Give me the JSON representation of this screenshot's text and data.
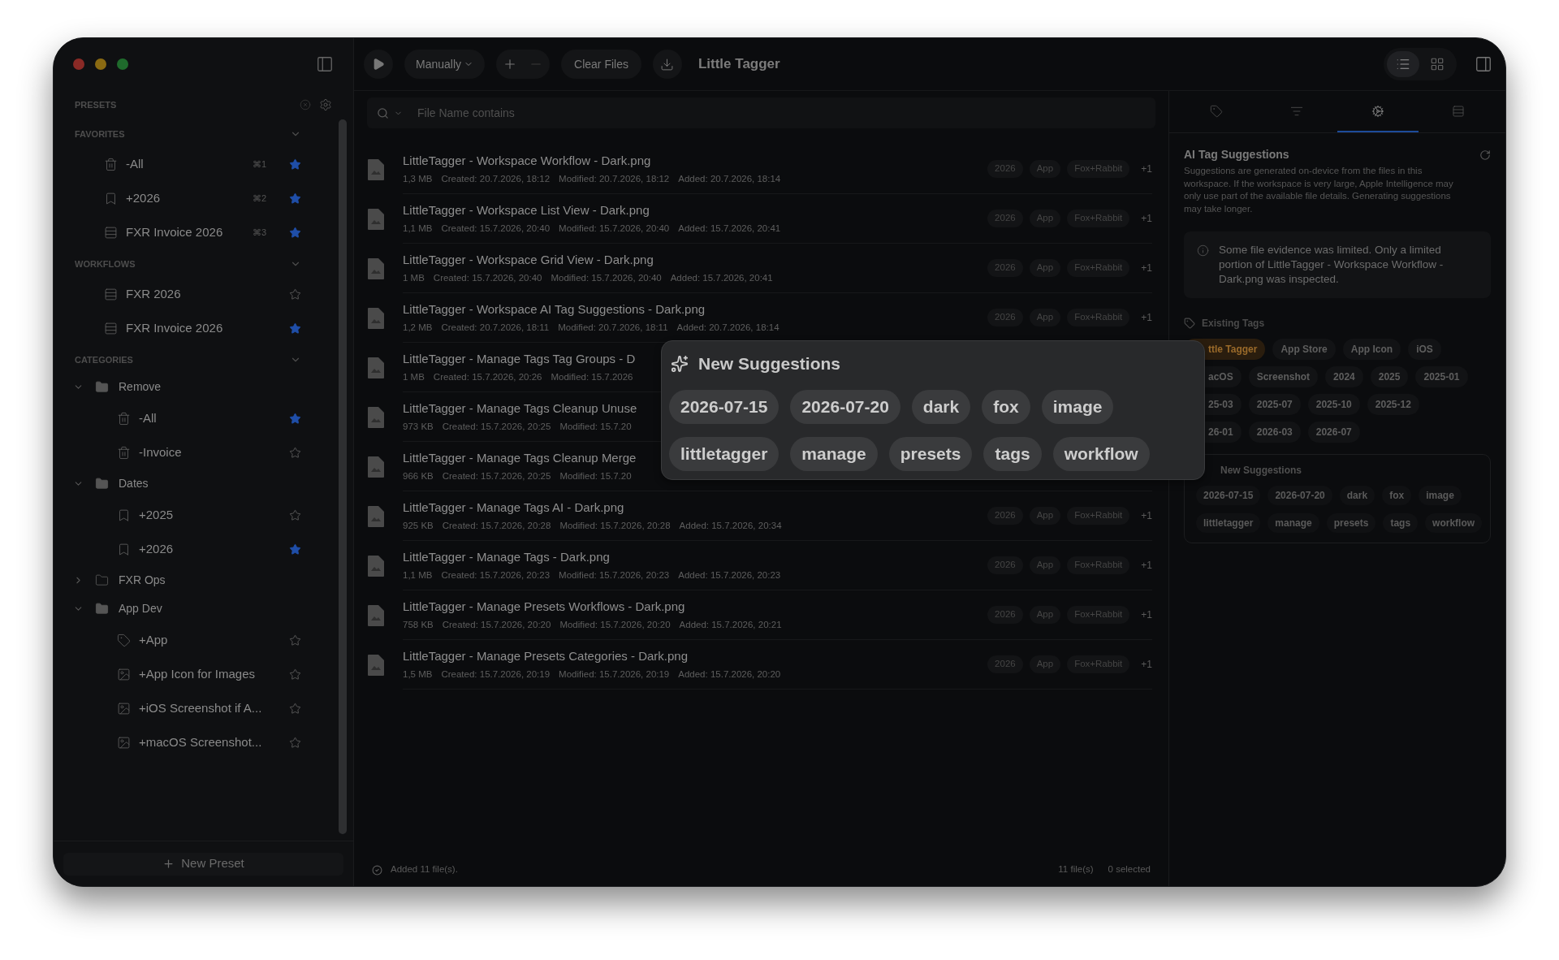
{
  "window": {
    "title": "Little Tagger"
  },
  "toolbar": {
    "run_mode": "Manually",
    "remove_disabled": true,
    "clear_button": "Clear Files",
    "views": [
      {
        "kind": "list",
        "selected": true
      },
      {
        "kind": "grid",
        "selected": false
      }
    ]
  },
  "sidebar": {
    "title": "PRESETS",
    "sections": [
      {
        "title": "FAVORITES",
        "expanded": true,
        "items": [
          {
            "kind": "remove",
            "label": "-All",
            "shortcut": "⌘1",
            "starred": true
          },
          {
            "kind": "add",
            "label": "+2026",
            "shortcut": "⌘2",
            "starred": true
          },
          {
            "kind": "workflow",
            "label": "FXR Invoice 2026",
            "shortcut": "⌘3",
            "starred": true
          }
        ]
      },
      {
        "title": "WORKFLOWS",
        "expanded": true,
        "items": [
          {
            "kind": "workflow",
            "label": "FXR 2026",
            "starred": false
          },
          {
            "kind": "workflow",
            "label": "FXR Invoice 2026",
            "starred": true
          }
        ]
      },
      {
        "title": "CATEGORIES",
        "expanded": true,
        "items": [
          {
            "kind": "folder",
            "label": "Remove",
            "expanded": true,
            "children": [
              {
                "kind": "remove",
                "label": "-All",
                "starred": true
              },
              {
                "kind": "remove",
                "label": "-Invoice",
                "starred": false
              }
            ]
          },
          {
            "kind": "folder",
            "label": "Dates",
            "expanded": true,
            "children": [
              {
                "kind": "add",
                "label": "+2025",
                "starred": false
              },
              {
                "kind": "add",
                "label": "+2026",
                "starred": true
              }
            ]
          },
          {
            "kind": "folder",
            "label": "FXR Ops",
            "expanded": false
          },
          {
            "kind": "folder",
            "label": "App Dev",
            "expanded": true,
            "children": [
              {
                "kind": "tag",
                "label": "+App",
                "starred": false
              },
              {
                "kind": "image",
                "label": "+App Icon for Images",
                "starred": false
              },
              {
                "kind": "image",
                "label": "+iOS Screenshot if A...",
                "starred": false
              },
              {
                "kind": "image",
                "label": "+macOS Screenshot...",
                "starred": false
              }
            ]
          }
        ]
      }
    ],
    "new_preset": "New Preset"
  },
  "search": {
    "placeholder": "File Name contains"
  },
  "files": [
    {
      "name": "LittleTagger - Workspace Workflow - Dark.png",
      "size": "1,3 MB",
      "created": "Created: 20.7.2026, 18:12",
      "modified": "Modified: 20.7.2026, 18:12",
      "added": "Added: 20.7.2026, 18:14",
      "tags": [
        "2026",
        "App",
        "Fox+Rabbit"
      ],
      "more": "+1"
    },
    {
      "name": "LittleTagger - Workspace List View - Dark.png",
      "size": "1,1 MB",
      "created": "Created: 15.7.2026, 20:40",
      "modified": "Modified: 15.7.2026, 20:40",
      "added": "Added: 15.7.2026, 20:41",
      "tags": [
        "2026",
        "App",
        "Fox+Rabbit"
      ],
      "more": "+1"
    },
    {
      "name": "LittleTagger - Workspace Grid View - Dark.png",
      "size": "1 MB",
      "created": "Created: 15.7.2026, 20:40",
      "modified": "Modified: 15.7.2026, 20:40",
      "added": "Added: 15.7.2026, 20:41",
      "tags": [
        "2026",
        "App",
        "Fox+Rabbit"
      ],
      "more": "+1"
    },
    {
      "name": "LittleTagger - Workspace AI Tag Suggestions - Dark.png",
      "size": "1,2 MB",
      "created": "Created: 20.7.2026, 18:11",
      "modified": "Modified: 20.7.2026, 18:11",
      "added": "Added: 20.7.2026, 18:14",
      "tags": [
        "2026",
        "App",
        "Fox+Rabbit"
      ],
      "more": "+1"
    },
    {
      "name": "LittleTagger - Manage Tags Tag Groups - D",
      "size": "1 MB",
      "created": "Created: 15.7.2026, 20:26",
      "modified": "Modified: 15.7.2026"
    },
    {
      "name": "LittleTagger - Manage Tags Cleanup Unuse",
      "size": "973 KB",
      "created": "Created: 15.7.2026, 20:25",
      "modified": "Modified: 15.7.20"
    },
    {
      "name": "LittleTagger - Manage Tags Cleanup Merge",
      "size": "966 KB",
      "created": "Created: 15.7.2026, 20:25",
      "modified": "Modified: 15.7.20"
    },
    {
      "name": "LittleTagger - Manage Tags AI - Dark.png",
      "size": "925 KB",
      "created": "Created: 15.7.2026, 20:28",
      "modified": "Modified: 15.7.2026, 20:28",
      "added": "Added: 15.7.2026, 20:34",
      "tags": [
        "2026",
        "App",
        "Fox+Rabbit"
      ],
      "more": "+1"
    },
    {
      "name": "LittleTagger - Manage Tags - Dark.png",
      "size": "1,1 MB",
      "created": "Created: 15.7.2026, 20:23",
      "modified": "Modified: 15.7.2026, 20:23",
      "added": "Added: 15.7.2026, 20:23",
      "tags": [
        "2026",
        "App",
        "Fox+Rabbit"
      ],
      "more": "+1"
    },
    {
      "name": "LittleTagger - Manage Presets Workflows - Dark.png",
      "size": "758 KB",
      "created": "Created: 15.7.2026, 20:20",
      "modified": "Modified: 15.7.2026, 20:20",
      "added": "Added: 15.7.2026, 20:21",
      "tags": [
        "2026",
        "App",
        "Fox+Rabbit"
      ],
      "more": "+1"
    },
    {
      "name": "LittleTagger - Manage Presets Categories - Dark.png",
      "size": "1,5 MB",
      "created": "Created: 15.7.2026, 20:19",
      "modified": "Modified: 15.7.2026, 20:19",
      "added": "Added: 15.7.2026, 20:20",
      "tags": [
        "2026",
        "App",
        "Fox+Rabbit"
      ],
      "more": "+1"
    }
  ],
  "status_bar": {
    "message": "Added 11 file(s).",
    "count": "11 file(s)",
    "selection": "0 selected"
  },
  "inspector": {
    "tabs": [
      {
        "kind": "tags",
        "selected": false
      },
      {
        "kind": "filters",
        "selected": false
      },
      {
        "kind": "ai",
        "selected": true
      },
      {
        "kind": "workflows",
        "selected": false
      }
    ],
    "title": "AI Tag Suggestions",
    "description": "Suggestions are generated on-device from the files in this workspace. If the workspace is very large, Apple Intelligence may only use part of the available file details. Generating suggestions may take longer.",
    "notice": "Some file evidence was limited. Only a limited portion of LittleTagger - Workspace Workflow - Dark.png was inspected.",
    "existing_label": "Existing Tags",
    "existing_tag_rows": [
      [
        {
          "label": "ttle Tagger",
          "highlighted": true
        },
        {
          "label": "App Store",
          "highlighted": false
        },
        {
          "label": "App Icon",
          "highlighted": false
        },
        {
          "label": "iOS",
          "highlighted": false
        }
      ],
      [
        {
          "label": "acOS",
          "highlighted": false
        },
        {
          "label": "Screenshot",
          "highlighted": false
        },
        {
          "label": "2024",
          "highlighted": false
        },
        {
          "label": "2025",
          "highlighted": false
        },
        {
          "label": "2025-01",
          "highlighted": false
        }
      ],
      [
        {
          "label": "25-03",
          "highlighted": false
        },
        {
          "label": "2025-07",
          "highlighted": false
        },
        {
          "label": "2025-10",
          "highlighted": false
        },
        {
          "label": "2025-12",
          "highlighted": false
        }
      ],
      [
        {
          "label": "26-01",
          "highlighted": false
        },
        {
          "label": "2026-03",
          "highlighted": false
        },
        {
          "label": "2026-07",
          "highlighted": false
        }
      ]
    ],
    "suggestions_label": "New Suggestions",
    "suggestion_rows": [
      [
        "2026-07-15",
        "2026-07-20",
        "dark",
        "fox",
        "image"
      ],
      [
        "littletagger",
        "manage",
        "presets",
        "tags",
        "workflow"
      ]
    ]
  },
  "popover": {
    "title": "New Suggestions",
    "rows": [
      [
        "2026-07-15",
        "2026-07-20",
        "dark",
        "fox",
        "image"
      ],
      [
        "littletagger",
        "manage",
        "presets",
        "tags",
        "workflow"
      ]
    ]
  }
}
